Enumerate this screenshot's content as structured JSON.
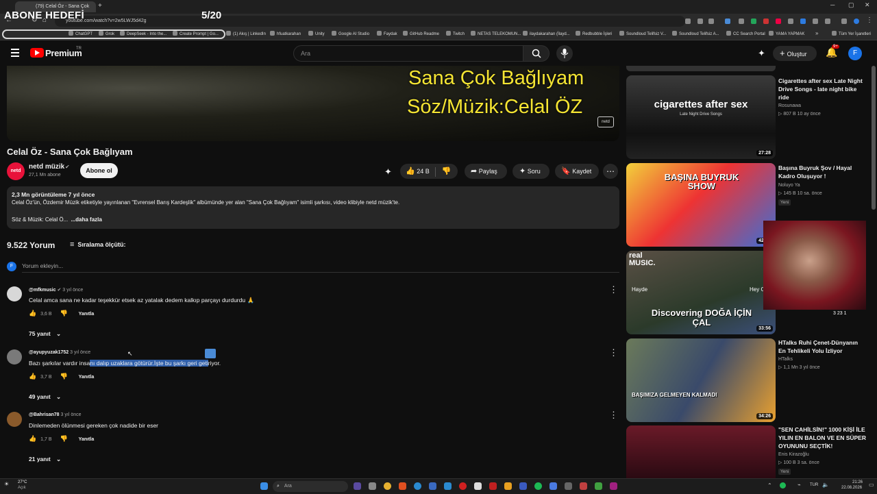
{
  "overlay": {
    "title": "ABONE HEDEFİ",
    "counter": "5/20"
  },
  "browser": {
    "active_tab": "(79) Celal Öz - Sana Çok Bağlıy...",
    "url": "youtube.com/watch?v=2w5LWJ5d42g",
    "bookmarks": [
      "ChatGPT",
      "Grok",
      "DeepSeek - Into the...",
      "Create Prompt | Go...",
      "(1) Akış | LinkedIn",
      "hfuatkarahan",
      "Unity",
      "Google AI Studio",
      "Faydak",
      "GitHub Readme",
      "Twitch",
      "NETAS TELEKOMUN...",
      "ilaydakarahan (İlayd...",
      "Redbubble İşleri",
      "Soundloud Telifsiz V...",
      "Soundloud Telifsiz A...",
      "CC Search Portal",
      "YAMA YAPMAK"
    ],
    "all_bookmarks": "Tüm Yer İşaretleri"
  },
  "header": {
    "logo": "Premium",
    "region": "TR",
    "search_placeholder": "Ara",
    "create_label": "Oluştur",
    "notif_count": "9+",
    "avatar_letter": "F"
  },
  "video": {
    "overlay_line1": "Sana Çok Bağlıyam",
    "overlay_line2": "Söz/Müzik:Celal ÖZ",
    "watermark": "netd",
    "title": "Celal Öz - Sana Çok Bağlıyam"
  },
  "channel": {
    "name": "netd müzik",
    "subs": "27,1 Mn abone",
    "subscribe": "Abone ol",
    "avatar_text": "netd"
  },
  "actions": {
    "likes": "24 B",
    "share": "Paylaş",
    "ask": "Soru",
    "save": "Kaydet"
  },
  "description": {
    "stats": "2,3 Mn görüntüleme  7 yıl önce",
    "line1": "Celal Öz'ün, Özdemir Müzik etiketiyle yayınlanan \"Evrensel Barış Kardeşlik\" albümünde yer alan \"Sana Çok Bağlıyam\" isimli şarkısı, video klibiyle netd müzik'te.",
    "line2": "Söz & Müzik: Celal Ö...",
    "more": "...daha fazla"
  },
  "comments": {
    "count": "9.522 Yorum",
    "sort_label": "Sıralama ölçütü:",
    "add_placeholder": "Yorum ekleyin...",
    "my_avatar": "F",
    "items": [
      {
        "user": "@mfkmusic",
        "time": "3 yıl önce",
        "text": "Celal amca sana ne kadar teşekkür etsek az yatalak dedem kalkıp parçayı durdurdu 🙏",
        "likes": "3,6 B",
        "reply": "Yanıtla",
        "replies": "75 yanıt"
      },
      {
        "user": "@ayupyuzak1752",
        "time": "3 yıl önce",
        "text_pre": "Bazı şarkılar vardır insa",
        "text_sel": "nı dalıp uzaklara götürür.İşte bu şarkı geri geti",
        "text_post": "riyor.",
        "likes": "3,7 B",
        "reply": "Yanıtla",
        "replies": "49 yanıt"
      },
      {
        "user": "@Bahrisan78",
        "time": "3 yıl önce",
        "text": "Dinlemeden ölünmesi gereken çok nadide bir eser",
        "likes": "1,7 B",
        "reply": "Yanıtla",
        "replies": "21 yanıt"
      }
    ]
  },
  "sidebar": [
    {
      "title": "Cigarettes after sex Late Night Drive Songs - late night bike ride",
      "channel": "Rosunawa",
      "meta": "▷ 807 B  10 ay önce",
      "duration": "27:28",
      "thumb_text": "cigarettes after sex",
      "thumb_sub": "Late Night Drive Songs"
    },
    {
      "title": "Başına Buyruk Şov / Hayal Kadro Oluşuyor !",
      "channel": "Noluyo Ya",
      "meta": "▷ 145 B  10 sa. önce",
      "badge": "Yeni",
      "duration": "42:20",
      "thumb_text": "BAŞINA BUYRUK SHOW"
    },
    {
      "title": "",
      "channel": "",
      "meta": "",
      "duration": "33:56",
      "thumb_text": "Discovering DOĞA İÇİN ÇAL",
      "thumb_sub": "real MUSIC.",
      "extra1": "Hayde",
      "extra2": "Hey Onb"
    },
    {
      "title": "HTalks Ruhi Çenet-Dünyanın En Tehlikeli Yolu İzliyor",
      "channel": "HTalks",
      "meta": "▷ 1,1 Mn  3 yıl önce",
      "duration": "34:26",
      "thumb_text": "BAŞIMIZA GELMEYEN KALMADI"
    },
    {
      "title": "\"SEN CAHİLSİN!\" 1000 KİŞİ İLE YILIN EN BALON VE EN SÜPER OYUNUNU SEÇTİK!",
      "channel": "Enis Kirazoğlu",
      "meta": "▷ 100 B  3 sa. önce",
      "badge": "Yeni",
      "duration": ""
    }
  ],
  "stream": {
    "stats": "3  23  1"
  },
  "taskbar": {
    "weather": "27°C",
    "weather_sub": "Açık",
    "search": "Ara",
    "lang": "TUR",
    "time": "21:26",
    "date": "22.08.2026"
  }
}
